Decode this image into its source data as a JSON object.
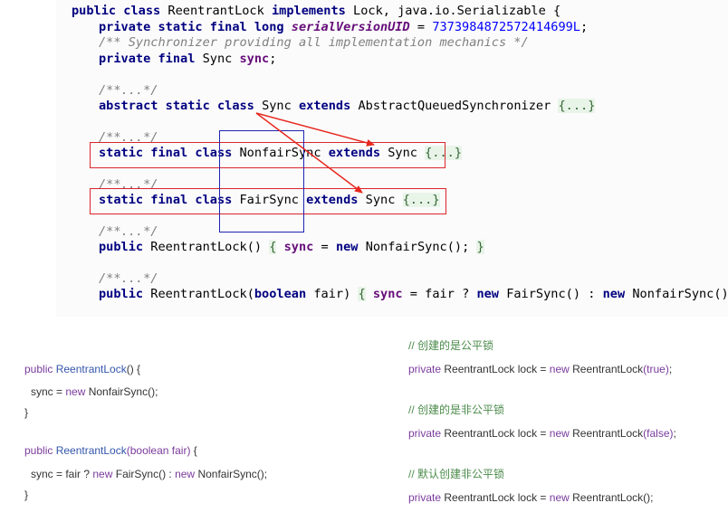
{
  "ide_code": {
    "lines": [
      [
        [
          "kw",
          "public class "
        ],
        [
          "",
          "ReentrantLock "
        ],
        [
          "kw",
          "implements "
        ],
        [
          "",
          "Lock, java.io.Serializable {"
        ]
      ],
      [
        [
          "kw",
          "private static final long "
        ],
        [
          "fldi",
          "serialVersionUID"
        ],
        [
          "",
          " = "
        ],
        [
          "num",
          "7373984872572414699L"
        ],
        [
          "",
          ";"
        ]
      ],
      [
        [
          "cm",
          "/** Synchronizer providing all implementation mechanics */"
        ]
      ],
      [
        [
          "kw",
          "private final "
        ],
        [
          "",
          "Sync "
        ],
        [
          "fld",
          "sync"
        ],
        [
          "",
          ";"
        ]
      ],
      [
        [
          "cm",
          "/**...*/"
        ]
      ],
      [
        [
          "kw",
          "abstract static class "
        ],
        [
          "",
          "Sync "
        ],
        [
          "kw",
          "extends "
        ],
        [
          "",
          "AbstractQueuedSynchronizer "
        ],
        [
          "fold",
          "{...}"
        ]
      ],
      [
        [
          "cm",
          "/**...*/"
        ]
      ],
      [
        [
          "kw",
          "static final class "
        ],
        [
          "",
          "NonfairSync "
        ],
        [
          "kw",
          "extends "
        ],
        [
          "",
          "Sync "
        ],
        [
          "fold",
          "{...}"
        ]
      ],
      [
        [
          "cm",
          "/**...*/"
        ]
      ],
      [
        [
          "kw",
          "static final class "
        ],
        [
          "",
          "FairSync "
        ],
        [
          "kw",
          "extends "
        ],
        [
          "",
          "Sync "
        ],
        [
          "fold",
          "{...}"
        ]
      ],
      [
        [
          "cm",
          "/**...*/"
        ]
      ],
      [
        [
          "kw",
          "public "
        ],
        [
          "",
          "ReentrantLock() "
        ],
        [
          "fold",
          "{"
        ],
        [
          "",
          " "
        ],
        [
          "fld",
          "sync"
        ],
        [
          "",
          " = "
        ],
        [
          "kw",
          "new "
        ],
        [
          "",
          "NonfairSync(); "
        ],
        [
          "fold",
          "}"
        ]
      ],
      [
        [
          "cm",
          "/**...*/"
        ]
      ],
      [
        [
          "kw",
          "public "
        ],
        [
          "",
          "ReentrantLock("
        ],
        [
          "kw",
          "boolean "
        ],
        [
          "",
          "fair) "
        ],
        [
          "fold",
          "{"
        ],
        [
          "",
          " "
        ],
        [
          "fld",
          "sync"
        ],
        [
          "",
          " = fair ? "
        ],
        [
          "kw",
          "new "
        ],
        [
          "",
          "FairSync() : "
        ],
        [
          "kw",
          "new "
        ],
        [
          "",
          "NonfairSync(); "
        ],
        [
          "fold",
          "}"
        ]
      ]
    ]
  },
  "snippet_left": {
    "lines": [
      [
        [
          "p",
          "public "
        ],
        [
          "f",
          "ReentrantLock"
        ],
        [
          "",
          "() {"
        ]
      ],
      [
        [
          "",
          "sync = "
        ],
        [
          "p",
          "new "
        ],
        [
          "",
          "NonfairSync();"
        ]
      ],
      [
        [
          "",
          "}"
        ]
      ],
      [
        [
          "p",
          "public "
        ],
        [
          "f",
          "ReentrantLock"
        ],
        [
          "p",
          "(boolean fair)"
        ],
        [
          "",
          " {"
        ]
      ],
      [
        [
          "",
          "sync = fair ? "
        ],
        [
          "p",
          "new "
        ],
        [
          "",
          "FairSync() : "
        ],
        [
          "p",
          "new "
        ],
        [
          "",
          "NonfairSync();"
        ]
      ],
      [
        [
          "",
          "}"
        ]
      ]
    ]
  },
  "snippet_right": {
    "lines": [
      [
        [
          "c",
          "// 创建的是公平锁"
        ]
      ],
      [
        [
          "p",
          "private "
        ],
        [
          "",
          "ReentrantLock lock = "
        ],
        [
          "p",
          "new "
        ],
        [
          "",
          "ReentrantLock"
        ],
        [
          "p",
          "(true)"
        ],
        [
          "",
          ";"
        ]
      ],
      [
        [
          "c",
          "// 创建的是非公平锁"
        ]
      ],
      [
        [
          "p",
          "private "
        ],
        [
          "",
          "ReentrantLock lock = "
        ],
        [
          "p",
          "new "
        ],
        [
          "",
          "ReentrantLock"
        ],
        [
          "p",
          "(false)"
        ],
        [
          "",
          ";"
        ]
      ],
      [
        [
          "c",
          "// 默认创建非公平锁"
        ]
      ],
      [
        [
          "p",
          "private "
        ],
        [
          "",
          "ReentrantLock lock = "
        ],
        [
          "p",
          "new "
        ],
        [
          "",
          "ReentrantLock();"
        ]
      ]
    ]
  },
  "colors": {
    "highlight_box": "#d9262d",
    "column_box": "#1f24b0",
    "arrow": "#e8281f"
  }
}
